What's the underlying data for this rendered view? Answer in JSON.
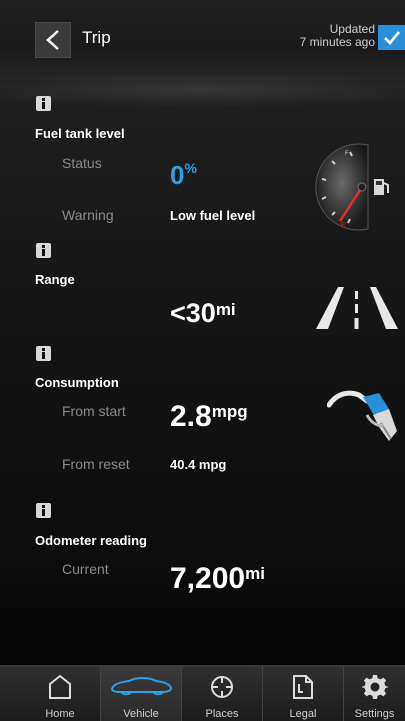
{
  "header": {
    "title": "Trip",
    "updated_line1": "Updated",
    "updated_line2": "7 minutes ago"
  },
  "fuel": {
    "title": "Fuel tank level",
    "status_label": "Status",
    "status_value": "0",
    "status_unit": "%",
    "warning_label": "Warning",
    "warning_value": "Low fuel level"
  },
  "range": {
    "title": "Range",
    "value": "<30",
    "unit": "mi"
  },
  "consumption": {
    "title": "Consumption",
    "from_start_label": "From start",
    "from_start_value": "2.8",
    "from_start_unit": "mpg",
    "from_reset_label": "From reset",
    "from_reset_value": "40.4 mpg"
  },
  "odometer": {
    "title": "Odometer reading",
    "current_label": "Current",
    "value": "7,200",
    "unit": "mi"
  },
  "nav": {
    "items": [
      {
        "label": "Home",
        "icon": "home-icon"
      },
      {
        "label": "Vehicle",
        "icon": "car-icon"
      },
      {
        "label": "Places",
        "icon": "crosshair-icon"
      },
      {
        "label": "Legal",
        "icon": "document-icon"
      },
      {
        "label": "Settings",
        "icon": "gear-icon"
      }
    ],
    "active": "Vehicle"
  },
  "colors": {
    "accent": "#2fa0e4",
    "checkbox": "#2a8fd8",
    "needle": "#e0302a"
  }
}
